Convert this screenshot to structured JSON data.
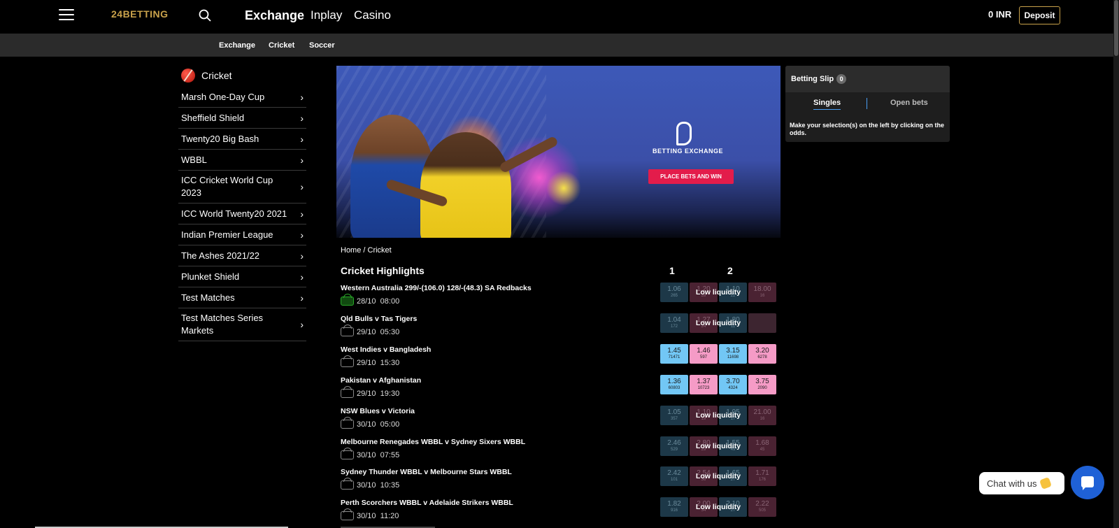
{
  "header": {
    "logo": "24BETTING",
    "nav": [
      "Exchange",
      "Inplay",
      "Casino"
    ],
    "balance": "0 INR",
    "deposit_label": "Deposit"
  },
  "subnav": [
    "Exchange",
    "Cricket",
    "Soccer"
  ],
  "sidebar": {
    "title": "Cricket",
    "items": [
      "Marsh One-Day Cup",
      "Sheffield Shield",
      "Twenty20 Big Bash",
      "WBBL",
      "ICC Cricket World Cup 2023",
      "ICC World Twenty20 2021",
      "Indian Premier League",
      "The Ashes 2021/22",
      "Plunket Shield",
      "Test Matches",
      "Test Matches Series Markets"
    ]
  },
  "banner": {
    "brand_text": "BETTING EXCHANGE",
    "cta": "PLACE BETS AND WIN"
  },
  "breadcrumb": "Home / Cricket",
  "highlights": {
    "title": "Cricket Highlights",
    "col1": "1",
    "col2": "2",
    "low_liquidity": "Low liquidity",
    "matches": [
      {
        "name": "Western Australia 299/-(106.0) 128/-(48.3) SA Redbacks",
        "date": "28/10",
        "time": "08:00",
        "live": true,
        "low": true,
        "odds": [
          {
            "p": "1.06",
            "s": "265"
          },
          {
            "p": "1.20",
            "s": "28"
          },
          {
            "p": "1.10",
            "s": "22"
          },
          {
            "p": "18.00",
            "s": "16"
          }
        ]
      },
      {
        "name": "Qld Bulls v Tas Tigers",
        "date": "29/10",
        "time": "05:30",
        "live": false,
        "low": true,
        "odds": [
          {
            "p": "1.04",
            "s": "172"
          },
          {
            "p": "1.27",
            "s": "24"
          },
          {
            "p": "1.80",
            "s": "11"
          },
          {
            "p": "",
            "s": ""
          }
        ]
      },
      {
        "name": "West Indies v Bangladesh",
        "date": "29/10",
        "time": "15:30",
        "live": false,
        "low": false,
        "odds": [
          {
            "p": "1.45",
            "s": "71471"
          },
          {
            "p": "1.46",
            "s": "597"
          },
          {
            "p": "3.15",
            "s": "11698"
          },
          {
            "p": "3.20",
            "s": "6278"
          }
        ]
      },
      {
        "name": "Pakistan v Afghanistan",
        "date": "29/10",
        "time": "19:30",
        "live": false,
        "low": false,
        "odds": [
          {
            "p": "1.36",
            "s": "60803"
          },
          {
            "p": "1.37",
            "s": "10723"
          },
          {
            "p": "3.70",
            "s": "4324"
          },
          {
            "p": "3.75",
            "s": "2090"
          }
        ]
      },
      {
        "name": "NSW Blues v Victoria",
        "date": "30/10",
        "time": "05:00",
        "live": false,
        "low": true,
        "odds": [
          {
            "p": "1.05",
            "s": "357"
          },
          {
            "p": "1.10",
            "s": "19"
          },
          {
            "p": "1.95",
            "s": "17"
          },
          {
            "p": "21.00",
            "s": "16"
          }
        ]
      },
      {
        "name": "Melbourne Renegades WBBL v Sydney Sixers WBBL",
        "date": "30/10",
        "time": "07:55",
        "live": false,
        "low": true,
        "odds": [
          {
            "p": "2.46",
            "s": "529"
          },
          {
            "p": "2.80",
            "s": "29"
          },
          {
            "p": "1.55",
            "s": "49"
          },
          {
            "p": "1.68",
            "s": "45"
          }
        ]
      },
      {
        "name": "Sydney Thunder WBBL v Melbourne Stars WBBL",
        "date": "30/10",
        "time": "10:35",
        "live": false,
        "low": true,
        "odds": [
          {
            "p": "2.42",
            "s": "101"
          },
          {
            "p": "2.54",
            "s": "36"
          },
          {
            "p": "1.65",
            "s": "27"
          },
          {
            "p": "1.71",
            "s": "176"
          }
        ]
      },
      {
        "name": "Perth Scorchers WBBL v Adelaide Strikers WBBL",
        "date": "30/10",
        "time": "11:20",
        "live": false,
        "low": true,
        "odds": [
          {
            "p": "1.82",
            "s": "916"
          },
          {
            "p": "2.00",
            "s": "34"
          },
          {
            "p": "2.10",
            "s": "27"
          },
          {
            "p": "2.22",
            "s": "505"
          }
        ]
      }
    ]
  },
  "slip": {
    "title": "Betting Slip",
    "count": "0",
    "tab_singles": "Singles",
    "tab_open": "Open bets",
    "message": "Make your selection(s) on the left by clicking on the odds."
  },
  "chat": {
    "label": "Chat with us"
  }
}
